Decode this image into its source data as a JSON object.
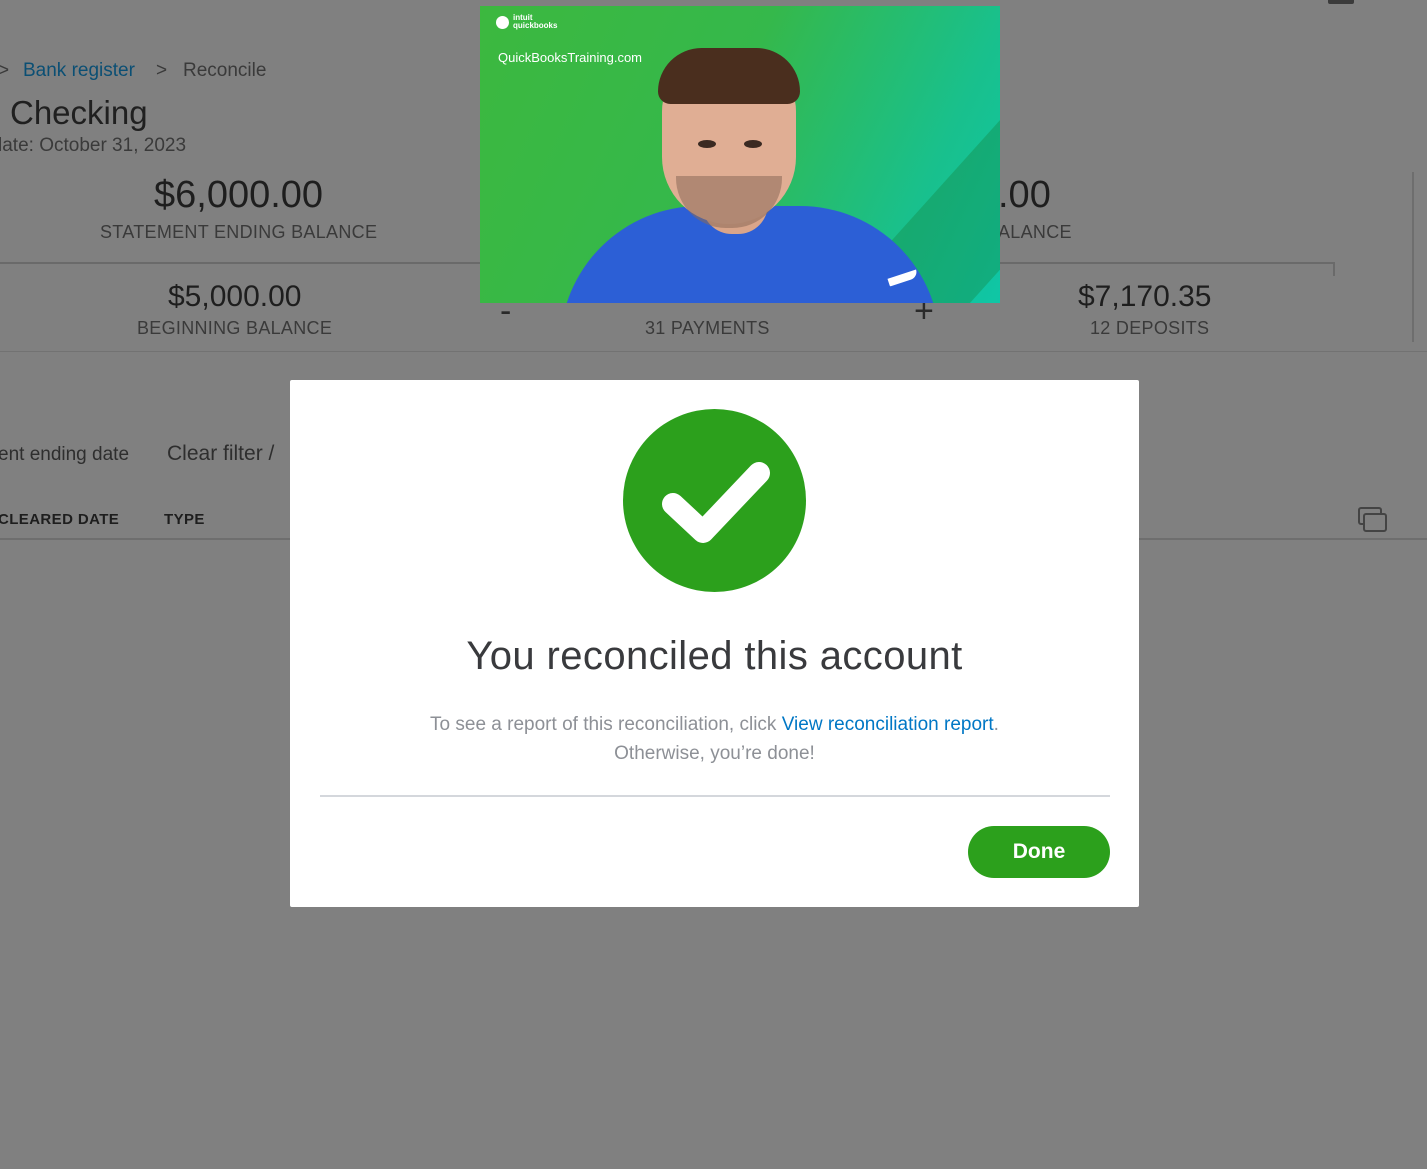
{
  "breadcrumb": {
    "separator": ">",
    "bank_register": "Bank register",
    "reconcile": "Reconcile"
  },
  "account": {
    "title": "Checking",
    "statement_date": "late: October 31, 2023"
  },
  "summary": {
    "statement_ending_balance": {
      "amount": "$6,000.00",
      "label": "STATEMENT ENDING BALANCE"
    },
    "cleared_balance": {
      "amount": ".00",
      "label": "ALANCE"
    },
    "beginning_balance": {
      "amount": "$5,000.00",
      "label": "BEGINNING BALANCE"
    },
    "minus_sign": "-",
    "payments": {
      "label": "31 PAYMENTS"
    },
    "plus_sign": "+",
    "deposits": {
      "amount": "$7,170.35",
      "label": "12 DEPOSITS"
    }
  },
  "filter": {
    "ending_date_label": "ent ending date",
    "clear_filter": "Clear filter /"
  },
  "table": {
    "columns": [
      "CLEARED DATE",
      "TYPE"
    ]
  },
  "video": {
    "logo_text": "intuit quickbooks",
    "site": "QuickBooksTraining.com"
  },
  "modal": {
    "title": "You reconciled this account",
    "body_prefix": "To see a report of this reconciliation, click ",
    "body_link": "View reconciliation report",
    "body_suffix": ".",
    "body_line2": "Otherwise, you’re done!",
    "done_label": "Done",
    "accent_color": "#2ca01c",
    "link_color": "#0077c5"
  },
  "icons": [
    "check-icon",
    "copy-icon"
  ]
}
